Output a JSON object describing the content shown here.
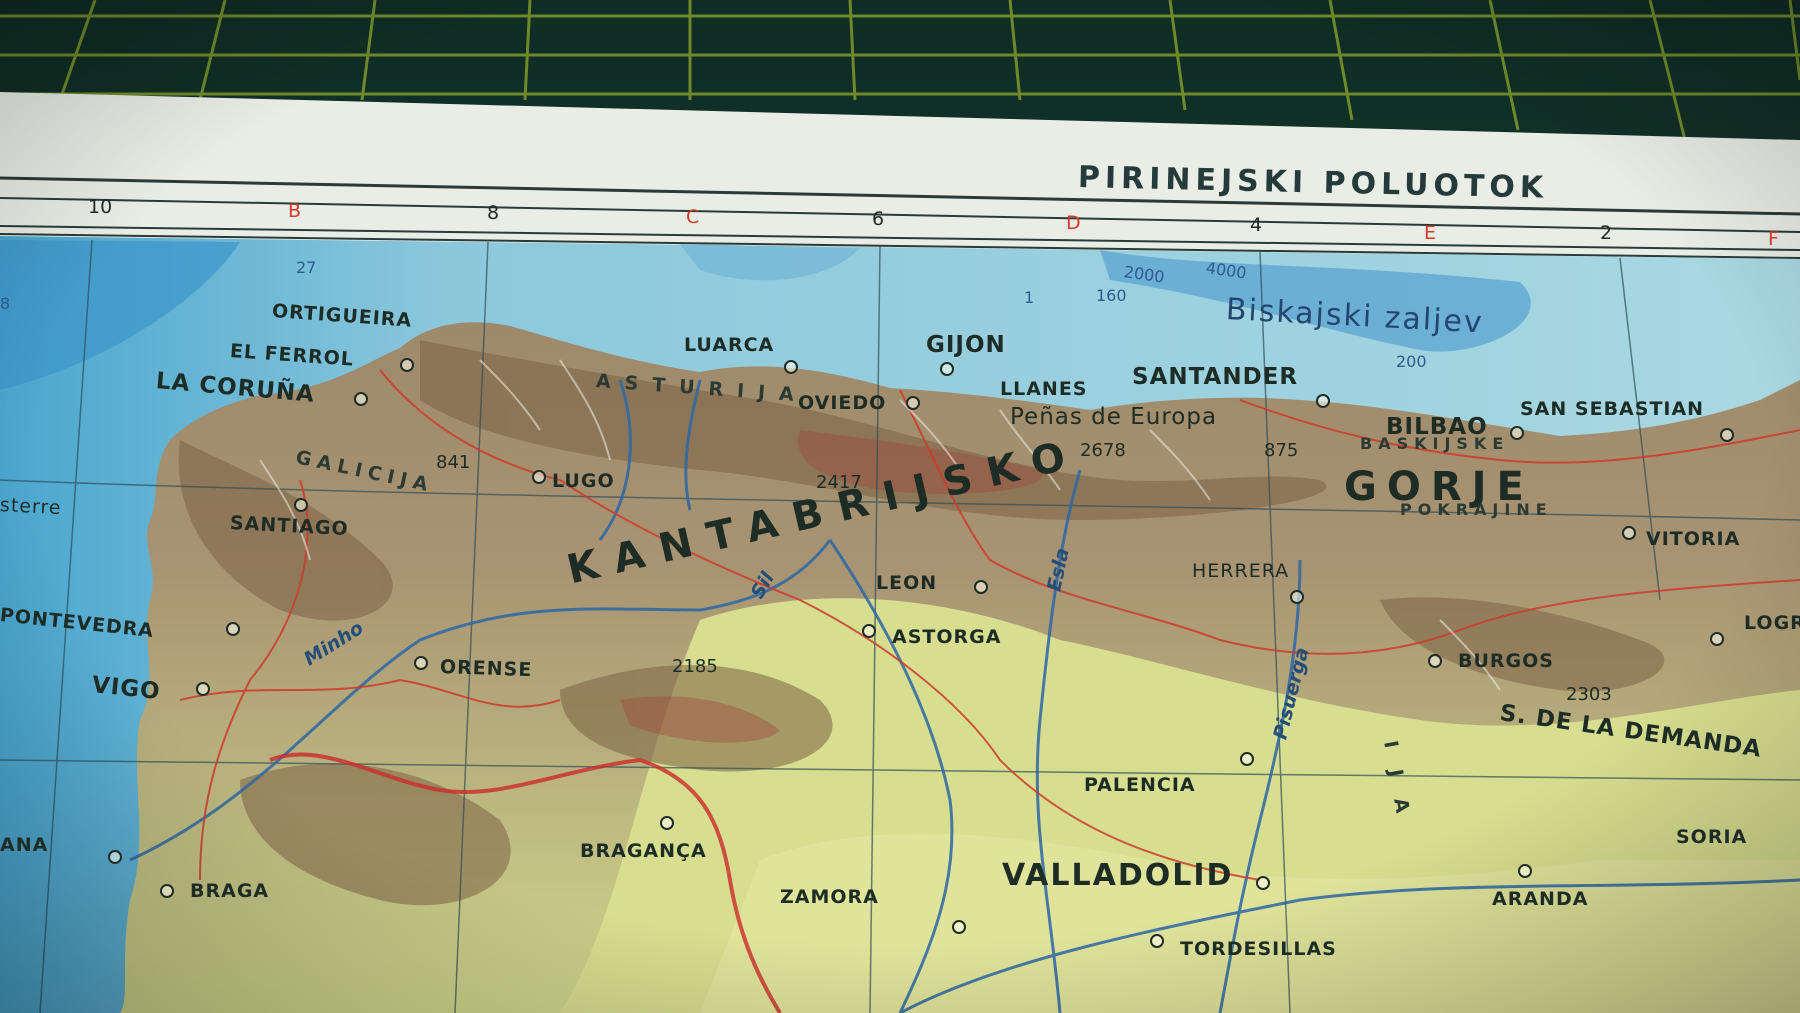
{
  "map": {
    "title": "PIRINEJSKI POLUOTOK",
    "sea_label": "Biskajski zaljev",
    "grid": {
      "numbers": [
        "10",
        "8",
        "6",
        "4",
        "2"
      ],
      "letters": [
        "B",
        "C",
        "D",
        "E",
        "F"
      ]
    },
    "depths": [
      "27",
      "2000",
      "4000",
      "160",
      "200",
      "1",
      "8"
    ],
    "places": {
      "ortigueira": "ORTIGUEIRA",
      "el_ferrol": "EL FERROL",
      "la_coruna": "LA CORUÑA",
      "luarca": "LUARCA",
      "gijon": "GIJON",
      "santander": "SANTANDER",
      "llanes": "LLANES",
      "oviedo": "OVIEDO",
      "picos": "Peñas de Europa",
      "bilbao": "BILBAO",
      "san_sebastian": "SAN SEBASTIAN",
      "lugo": "LUGO",
      "santiago": "SANTIAGO",
      "finisterre": "sterre",
      "pontevedra": "PONTEVEDRA",
      "vigo": "VIGO",
      "orense": "ORENSE",
      "leon": "LEON",
      "astorga": "ASTORGA",
      "herrera": "HERRERA",
      "vitoria": "VITORIA",
      "burgos": "BURGOS",
      "logrono": "LOGR",
      "palencia": "PALENCIA",
      "valladolid": "VALLADOLID",
      "zamora": "ZAMORA",
      "braganca": "BRAGANÇA",
      "braga": "BRAGA",
      "tordesillas": "TORDESILLAS",
      "soria": "SORIA",
      "aranda": "ARANDA",
      "viana": "ANA"
    },
    "regions": {
      "galicija": "GALICIJA",
      "asturija": "ASTURIJA",
      "kantabrijsko": "KANTABRIJSKO",
      "gorje": "GORJE",
      "baskijske": "BASKIJSKE",
      "pokrajine": "POKRAJINE",
      "demanda": "S. DE LA DEMANDA",
      "ija": "IJA"
    },
    "peaks": [
      "841",
      "2417",
      "2678",
      "875",
      "2185",
      "2303"
    ],
    "rivers": {
      "minho": "Minho",
      "esla": "Esla",
      "pisuerga": "Pisuerga",
      "sil": "Sil"
    }
  }
}
